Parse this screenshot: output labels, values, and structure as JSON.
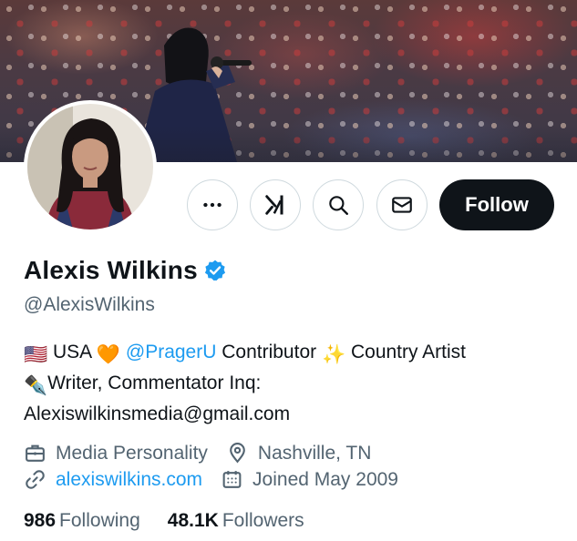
{
  "profile": {
    "display_name": "Alexis Wilkins",
    "handle": "@AlexisWilkins",
    "verified": true
  },
  "actions": {
    "more_icon": "more-icon",
    "grok_icon": "grok-icon",
    "search_icon": "search-icon",
    "message_icon": "message-icon",
    "follow_label": "Follow"
  },
  "bio": {
    "flag": "🇺🇸",
    "country": "USA",
    "heart": "🧡",
    "mention": "@PragerU",
    "contributor": "Contributor",
    "sparkles": "✨",
    "line1_tail": "Country Artist",
    "pen": "✒️",
    "line2": "Writer, Commentator Inq:",
    "line3": "Alexiswilkinsmedia@gmail.com"
  },
  "meta": {
    "category": "Media Personality",
    "location": "Nashville, TN",
    "website": "alexiswilkins.com",
    "joined": "Joined May 2009"
  },
  "stats": {
    "following_count": "986",
    "following_label": "Following",
    "followers_count": "48.1K",
    "followers_label": "Followers"
  },
  "colors": {
    "accent": "#1d9bf0",
    "text": "#0f1419",
    "secondary": "#536471",
    "border": "#cfd9de",
    "follow_bg": "#0f1419"
  }
}
